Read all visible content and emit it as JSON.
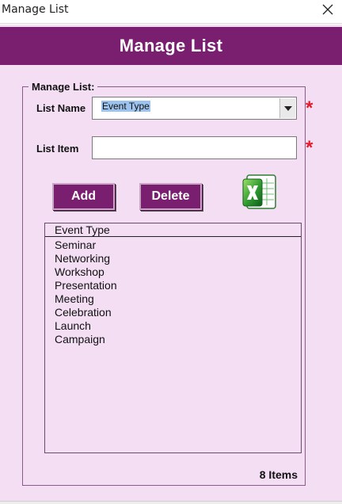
{
  "window": {
    "title": "Manage List"
  },
  "header": {
    "title": "Manage List"
  },
  "form": {
    "group_label": "Manage List:",
    "list_name_label": "List Name",
    "list_name_value": "Event Type",
    "list_item_label": "List Item",
    "list_item_value": "",
    "required_marker": "*"
  },
  "buttons": {
    "add": "Add",
    "delete": "Delete"
  },
  "excel_icon": "excel-icon",
  "listbox": {
    "header": "Event Type",
    "items": [
      "Seminar",
      "Networking",
      "Workshop",
      "Presentation",
      "Meeting",
      "Celebration",
      "Launch",
      "Campaign"
    ]
  },
  "count_text": "8 Items",
  "colors": {
    "accent": "#7a1e70",
    "background": "#f4def4",
    "required": "#e21b2a",
    "selection": "#9cc3ee"
  }
}
